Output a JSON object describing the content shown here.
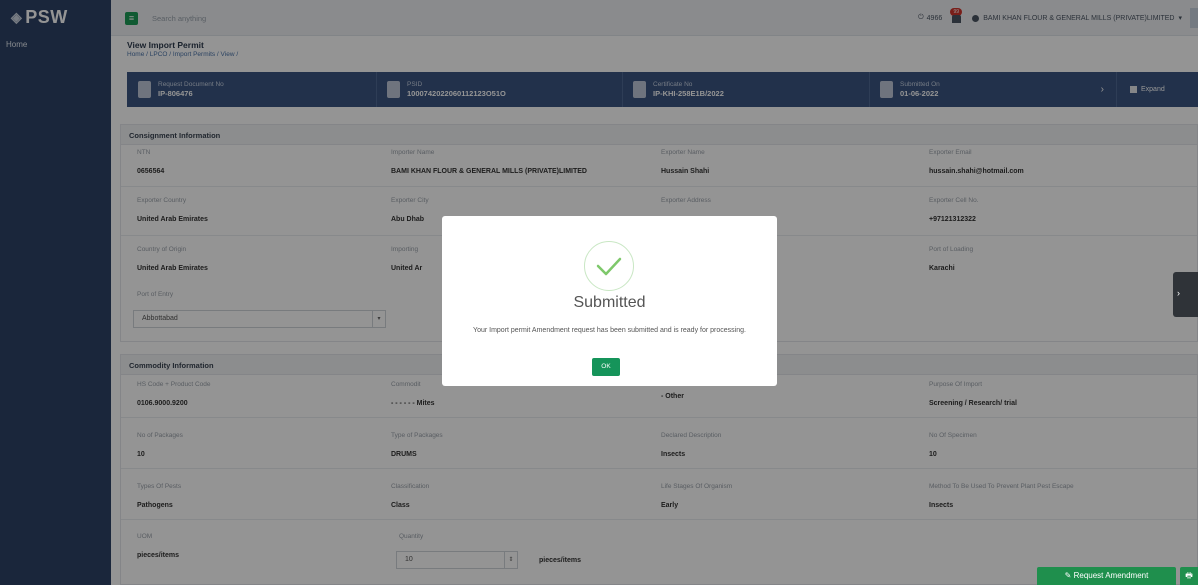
{
  "brand": {
    "logo_text": "PSW",
    "logo_mark": "◈"
  },
  "sidebar": {
    "items": [
      {
        "label": "Home"
      }
    ]
  },
  "topbar": {
    "menu_icon": "≡",
    "search_placeholder": "Search anything",
    "counter": "4966",
    "notification_badge": "99",
    "user_name": "BAMI KHAN FLOUR & GENERAL MILLS (PRIVATE)LIMITED",
    "user_caret": "▾"
  },
  "page": {
    "title": "View Import Permit",
    "breadcrumb": "Home / LPCO / Import Permits / View /"
  },
  "summary": [
    {
      "label": "Request Document No",
      "value": "IP-806476"
    },
    {
      "label": "PSID",
      "value": "1000742022060112123O51O"
    },
    {
      "label": "Certificate No",
      "value": "IP-KHI-258E1B/2022"
    },
    {
      "label": "Submitted On",
      "value": "01-06-2022"
    }
  ],
  "summary_expand": "Expand",
  "consignment": {
    "heading": "Consignment Information",
    "fields": [
      {
        "label": "NTN",
        "value": "0656564"
      },
      {
        "label": "Importer Name",
        "value": "BAMI KHAN FLOUR & GENERAL MILLS (PRIVATE)LIMITED"
      },
      {
        "label": "Exporter Name",
        "value": "Hussain Shahi"
      },
      {
        "label": "Exporter Email",
        "value": "hussain.shahi@hotmail.com"
      },
      {
        "label": "Exporter Country",
        "value": "United Arab Emirates"
      },
      {
        "label": "Exporter City",
        "value": "Abu Dhab"
      },
      {
        "label": "Exporter Address",
        "value": ""
      },
      {
        "label": "Exporter Cell No.",
        "value": "+97121312322"
      },
      {
        "label": "Country of Origin",
        "value": "United Arab Emirates"
      },
      {
        "label": "Importing",
        "value": "United Ar"
      },
      {
        "label": "",
        "value": ""
      },
      {
        "label": "Port of Loading",
        "value": "Karachi"
      },
      {
        "label": "Port of Entry",
        "value": ""
      }
    ],
    "port_of_entry_select": "Abbottabad"
  },
  "commodity": {
    "heading": "Commodity Information",
    "fields": [
      {
        "label": "HS Code + Product Code",
        "value": "0106.9000.9200"
      },
      {
        "label": "Commodit",
        "value": "- - - - - - Mites"
      },
      {
        "label": "",
        "value": "- Other"
      },
      {
        "label": "Purpose Of Import",
        "value": "Screening / Research/ trial"
      },
      {
        "label": "No of Packages",
        "value": "10"
      },
      {
        "label": "Type of Packages",
        "value": "DRUMS"
      },
      {
        "label": "Declared Description",
        "value": "Insects"
      },
      {
        "label": "No Of Specimen",
        "value": "10"
      },
      {
        "label": "Types Of Pests",
        "value": "Pathogens"
      },
      {
        "label": "Classification",
        "value": "Class"
      },
      {
        "label": "Life Stages Of Organism",
        "value": "Early"
      },
      {
        "label": "Method To Be Used To Prevent Plant Pest Escape",
        "value": "Insects"
      },
      {
        "label": "UOM",
        "value": "pieces/items"
      },
      {
        "label": "Quantity",
        "value": ""
      }
    ],
    "quantity_value": "10",
    "quantity_unit": "pieces/items"
  },
  "modal": {
    "title": "Submitted",
    "message": "Your Import permit Amendment request has been submitted and is ready for processing.",
    "ok_label": "OK"
  },
  "actions": {
    "request_amendment": "Request Amendment",
    "print_icon": "🖶"
  },
  "colors": {
    "sidebar": "#2e4366",
    "summary_bar": "#3b5581",
    "success": "#15945a",
    "action_button": "#1f8f4d"
  }
}
